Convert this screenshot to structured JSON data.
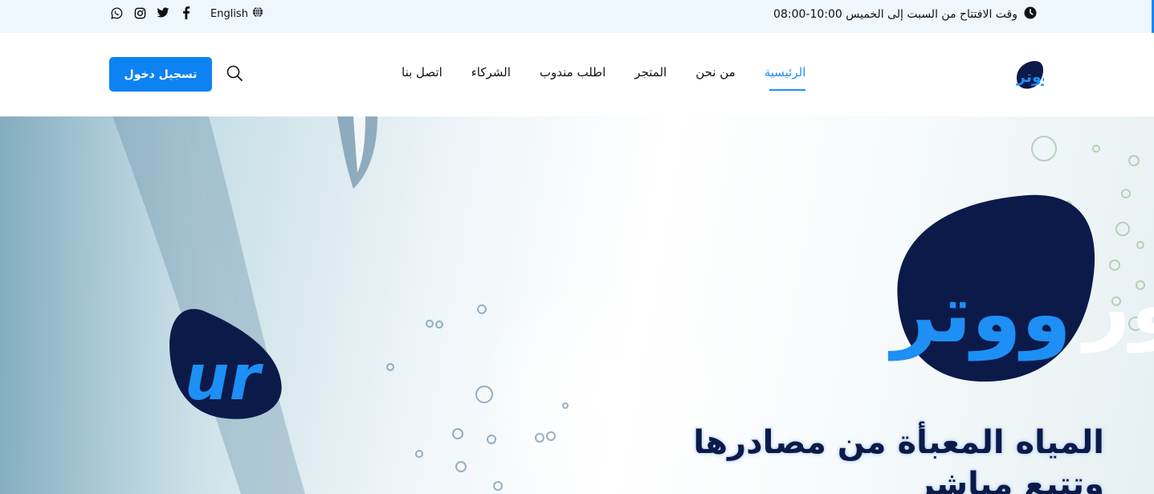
{
  "topbar": {
    "opening_hours": "وقت الافتتاح من السبت إلى الخميس 10:00-08:00",
    "language": "English",
    "social": [
      "whatsapp-icon",
      "instagram-icon",
      "twitter-icon",
      "facebook-icon"
    ]
  },
  "header": {
    "logo_text": "يور ووتر",
    "nav": [
      "الرئيسية",
      "من نحن",
      "المتجر",
      "اطلب مندوب",
      "الشركاء",
      "اتصل بنا"
    ],
    "active_index": 0,
    "login_label": "تسجيل دخول"
  },
  "hero": {
    "brand_arabic": "يور ووتر",
    "brand_latin_mark": "ur",
    "tagline": "المياه المعبأة من مصادرها وتتبع مباشر"
  },
  "colors": {
    "accent": "#0d82f2",
    "navy": "#0c1a4a",
    "topbar_bg": "#eef6fe"
  }
}
